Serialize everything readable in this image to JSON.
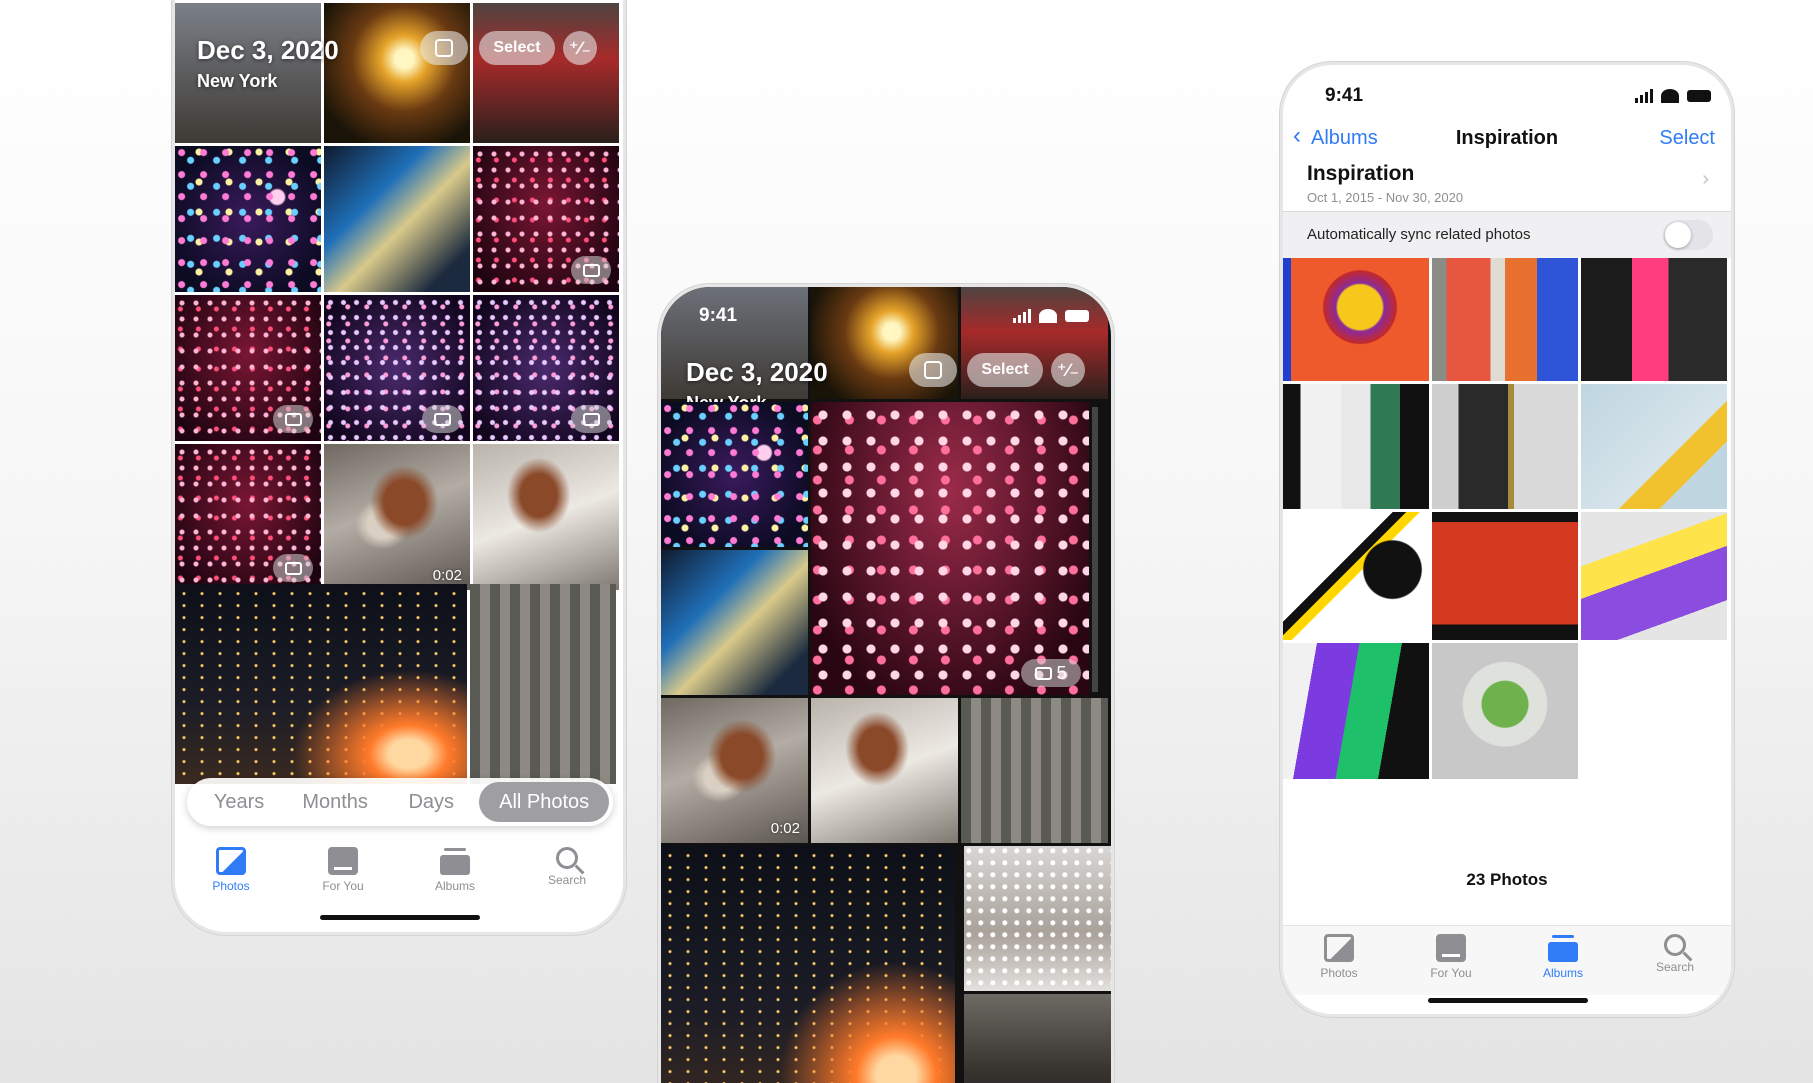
{
  "phone_left": {
    "header": {
      "date": "Dec 3, 2020",
      "location": "New York",
      "select_label": "Select"
    },
    "video_durations": {
      "dog_video": "0:02"
    },
    "segmented_control": [
      "Years",
      "Months",
      "Days",
      "All Photos"
    ],
    "segmented_active": "All Photos",
    "tabs": [
      {
        "label": "Photos",
        "icon": "photos-icon",
        "active": true
      },
      {
        "label": "For You",
        "icon": "for-you-icon",
        "active": false
      },
      {
        "label": "Albums",
        "icon": "albums-icon",
        "active": false
      },
      {
        "label": "Search",
        "icon": "search-icon",
        "active": false
      }
    ]
  },
  "phone_middle": {
    "status_time": "9:41",
    "header": {
      "date": "Dec 3, 2020",
      "location": "New York",
      "select_label": "Select"
    },
    "big_tile_count": "5",
    "video_durations": {
      "dog_video": "0:02"
    }
  },
  "phone_right": {
    "status_time": "9:41",
    "nav": {
      "back_label": "Albums",
      "title": "Inspiration",
      "select_label": "Select"
    },
    "album": {
      "name": "Inspiration",
      "date_range": "Oct 1, 2015 - Nov 30, 2020"
    },
    "sync_label": "Automatically sync related photos",
    "sync_enabled": false,
    "photo_count": "23 Photos",
    "tabs": [
      {
        "label": "Photos",
        "icon": "photos-icon",
        "active": false
      },
      {
        "label": "For You",
        "icon": "for-you-icon",
        "active": false
      },
      {
        "label": "Albums",
        "icon": "albums-icon",
        "active": true
      },
      {
        "label": "Search",
        "icon": "search-icon",
        "active": false
      }
    ]
  },
  "colors": {
    "accent": "#2f7cf6",
    "inactive": "#8e8e93"
  }
}
